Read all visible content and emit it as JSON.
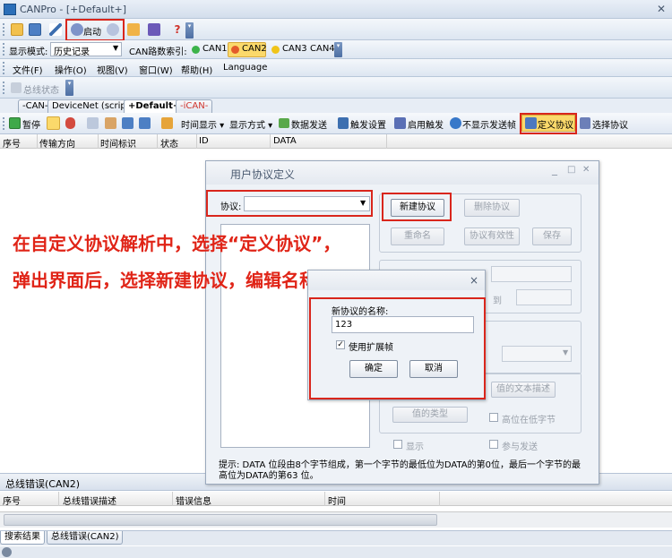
{
  "window": {
    "title": "CANPro - [+Default+]",
    "close": "✕"
  },
  "toolbar1": {
    "start_label": "启动"
  },
  "displaybar": {
    "mode_label": "显示模式:",
    "mode_value": "历史记录",
    "can_index_label": "CAN路数索引:",
    "channels": [
      {
        "label": "CAN1",
        "color": "#3cb34a"
      },
      {
        "label": "CAN2",
        "color": "#e35b2b"
      },
      {
        "label": "CAN3",
        "color": "#f0c419"
      },
      {
        "label": "CAN4",
        "color": ""
      }
    ]
  },
  "menu": {
    "items": [
      "文件(F)",
      "操作(O)",
      "视图(V)",
      "窗口(W)",
      "帮助(H)",
      "Language"
    ]
  },
  "statusbar_toolbar": {
    "label": "总线状态"
  },
  "tabs": [
    "-CAN-",
    "DeviceNet (script)",
    "+Default+",
    "-iCAN-"
  ],
  "toolbar2": {
    "pause": "暂停",
    "time_display": "时间显示",
    "display_mode": "显示方式",
    "data_send": "数据发送",
    "trigger_settings": "触发设置",
    "enable_trigger": "启用触发",
    "hide_send_frames": "不显示发送帧",
    "define_protocol": "定义协议",
    "select_protocol": "选择协议"
  },
  "table": {
    "columns": [
      "序号",
      "传输方向",
      "时间标识",
      "状态",
      "ID",
      "DATA"
    ]
  },
  "bottom_panel": {
    "title": "总线错误(CAN2)",
    "columns": [
      "序号",
      "总线错误描述",
      "错误信息",
      "时间"
    ],
    "tabs": [
      "搜索结果",
      "总线错误(CAN2)"
    ]
  },
  "dialog": {
    "title": "用户协议定义",
    "protocol_label": "协议:",
    "protocol_value": "",
    "new_protocol": "新建协议",
    "delete_protocol": "删除协议",
    "rename": "重命名",
    "protocol_validity": "协议有效性",
    "save": "保存",
    "partial_label": "到",
    "value_text_desc": "值的文本描述",
    "value_type": "值的类型",
    "high_bit_low_byte": "高位在低字节",
    "show": "显示",
    "join_send": "参与发送",
    "hint": "提示:  DATA 位段由8个字节组成，第一个字节的最低位为DATA的第0位，最后一个字节的最高位为DATA的第63 位。"
  },
  "subdialog": {
    "close": "×",
    "name_label": "新协议的名称:",
    "name_value": "123",
    "use_extended": "使用扩展帧",
    "use_extended_checked": true,
    "ok": "确定",
    "cancel": "取消"
  },
  "annotation": {
    "line1": "在自定义协议解析中，选择“定义协议”，",
    "line2": "弹出界面后，选择新建协议，编辑名称，"
  },
  "colors": {
    "annotation_red": "#e02417",
    "highlight": "#fbd96b"
  }
}
